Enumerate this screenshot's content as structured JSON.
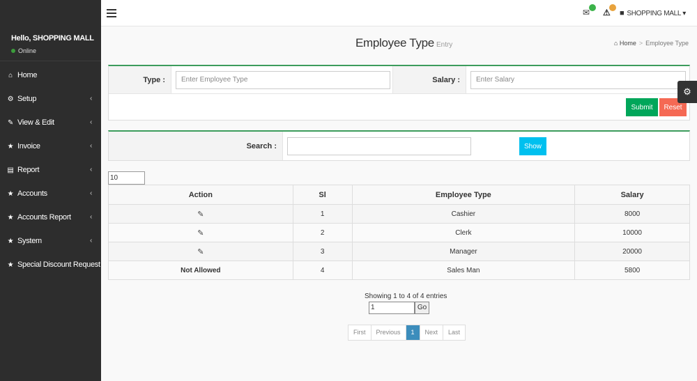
{
  "sidebar": {
    "greeting": "Hello, SHOPPING MALL",
    "status": "Online",
    "items": [
      {
        "label": "Home",
        "icon": "home-icon"
      },
      {
        "label": "Setup",
        "icon": "cogs-icon"
      },
      {
        "label": "View & Edit",
        "icon": "edit-icon"
      },
      {
        "label": "Invoice",
        "icon": "star-icon"
      },
      {
        "label": "Report",
        "icon": "file-icon"
      },
      {
        "label": "Accounts",
        "icon": "star-icon"
      },
      {
        "label": "Accounts Report",
        "icon": "star-icon"
      },
      {
        "label": "System",
        "icon": "star-icon"
      },
      {
        "label": "Special Discount Request",
        "icon": "star-icon"
      }
    ]
  },
  "topbar": {
    "user_name": "SHOPPING MALL",
    "mail_badge_color": "#3cb34a",
    "alert_badge_color": "#e8a33d"
  },
  "page": {
    "title": "Employee Type",
    "subtitle": "Entry",
    "breadcrumb_home": "Home",
    "breadcrumb_current": "Employee Type"
  },
  "form": {
    "type_label": "Type :",
    "type_placeholder": "Enter Employee Type",
    "salary_label": "Salary :",
    "salary_placeholder": "Enter Salary",
    "submit_label": "Submit",
    "reset_label": "Reset",
    "submit_color": "#00a65a",
    "reset_color": "#f56954"
  },
  "search": {
    "label": "Search :",
    "value": "",
    "show_label": "Show",
    "show_color": "#00c0ef"
  },
  "table": {
    "page_length": "10",
    "headers": [
      "Action",
      "Sl",
      "Employee Type",
      "Salary"
    ],
    "rows": [
      {
        "action": "",
        "editable": true,
        "sl": "1",
        "type": "Cashier",
        "salary": "8000"
      },
      {
        "action": "",
        "editable": true,
        "sl": "2",
        "type": "Clerk",
        "salary": "10000"
      },
      {
        "action": "",
        "editable": true,
        "sl": "3",
        "type": "Manager",
        "salary": "20000"
      },
      {
        "action": "Not Allowed",
        "editable": false,
        "sl": "4",
        "type": "Sales Man",
        "salary": "5800"
      }
    ],
    "info": "Showing 1 to 4 of 4 entries",
    "goto_value": "1",
    "go_label": "Go",
    "pager": [
      "First",
      "Previous",
      "1",
      "Next",
      "Last"
    ],
    "active_page": "1"
  }
}
